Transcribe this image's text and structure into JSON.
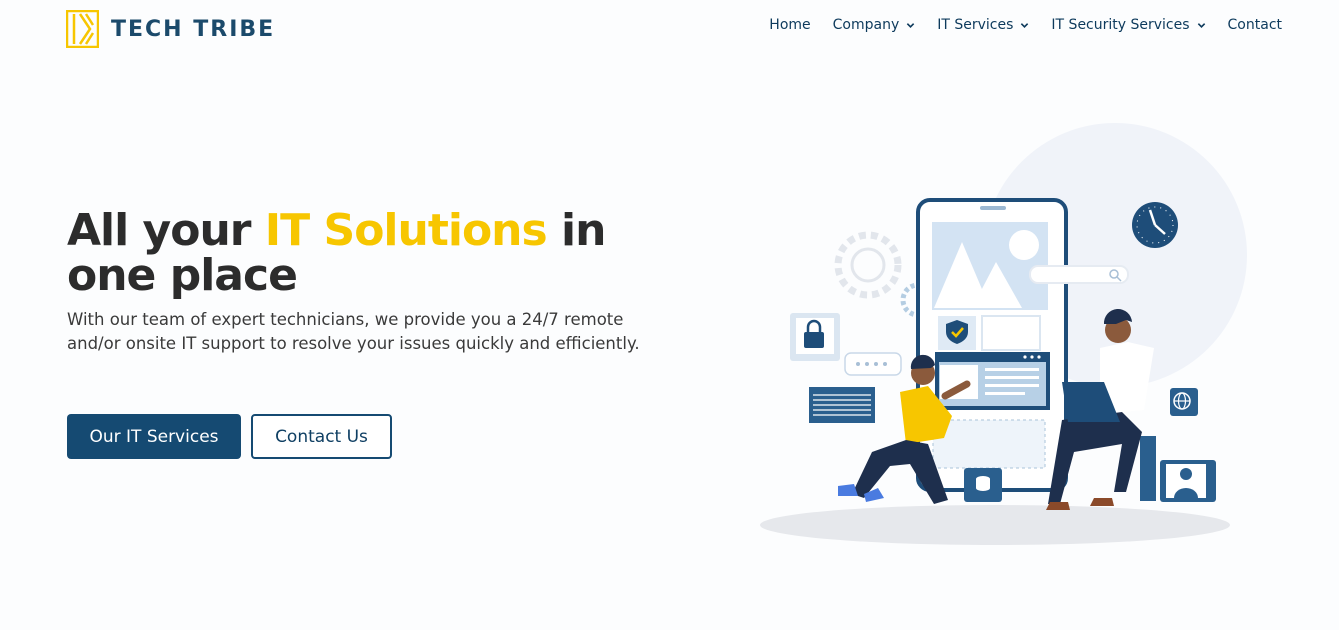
{
  "brand": {
    "name": "TECH TRIBE",
    "accent_color": "#f7c600",
    "primary_color": "#154a72"
  },
  "nav": {
    "items": [
      {
        "label": "Home",
        "has_dropdown": false
      },
      {
        "label": "Company",
        "has_dropdown": true
      },
      {
        "label": "IT Services",
        "has_dropdown": true
      },
      {
        "label": "IT Security Services",
        "has_dropdown": true
      },
      {
        "label": "Contact",
        "has_dropdown": false
      }
    ]
  },
  "hero": {
    "title_part1": "All your ",
    "title_accent": "IT Solutions",
    "title_part2": " in one place",
    "description": "With our team of expert technicians, we provide you a 24/7 remote and/or onsite IT support to resolve your issues quickly and efficiently.",
    "primary_button": "Our IT Services",
    "secondary_button": "Contact Us"
  },
  "icons": {
    "logo": "tech-tribe-logo-icon",
    "dropdown": "chevron-down-icon",
    "illustration": "it-support-illustration"
  }
}
